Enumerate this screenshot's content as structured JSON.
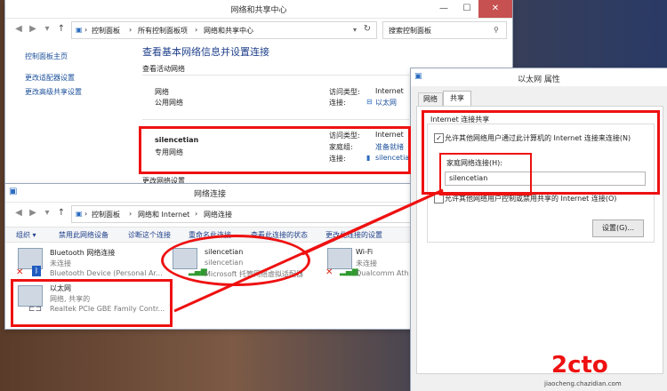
{
  "nsc": {
    "title": "网络和共享中心",
    "breadcrumb": [
      "控制面板",
      "所有控制面板项",
      "网络和共享中心"
    ],
    "search_placeholder": "搜索控制面板",
    "sidebar": [
      "控制面板主页",
      "更改适配器设置",
      "更改高级共享设置"
    ],
    "heading": "查看基本网络信息并设置连接",
    "active_label": "查看活动网络",
    "net1": {
      "name": "网络",
      "type": "公用网络",
      "access_k": "访问类型:",
      "access_v": "Internet",
      "conn_k": "连接:",
      "conn_v": "以太网"
    },
    "net2": {
      "name": "silencetian",
      "type": "专用网络",
      "access_k": "访问类型:",
      "access_v": "Internet",
      "home_k": "家庭组:",
      "home_v": "准备就绪",
      "conn_k": "连接:",
      "conn_v": "silencetia"
    },
    "cutoff": "更改网络设置"
  },
  "nc": {
    "title": "网络连接",
    "breadcrumb": [
      "控制面板",
      "网络和 Internet",
      "网络连接"
    ],
    "toolbar": [
      "组织 ▾",
      "禁用此网络设备",
      "诊断这个连接",
      "重命名此连接",
      "查看此连接的状态",
      "更改此连接的设置"
    ],
    "items": [
      {
        "name": "Bluetooth 网络连接",
        "status": "未连接",
        "device": "Bluetooth Device (Personal Ar..."
      },
      {
        "name": "silencetian",
        "status": "silencetian",
        "device": "Microsoft 托管网络虚拟适配器"
      },
      {
        "name": "Wi-Fi",
        "status": "未连接",
        "device": "Qualcomm Ath"
      },
      {
        "name": "以太网",
        "status": "网络, 共享的",
        "device": "Realtek PCIe GBE Family Contr..."
      }
    ]
  },
  "props": {
    "title": "以太网 属性",
    "tabs": [
      "网络",
      "共享"
    ],
    "group": "Internet 连接共享",
    "check1": "允许其他网络用户通过此计算机的 Internet 连接来连接(N)",
    "home_label": "家庭网络连接(H):",
    "home_value": "silencetian",
    "check2": "允许其他网络用户控制或禁用共享的 Internet 连接(O)",
    "settings_btn": "设置(G)..."
  },
  "watermark": "jiaocheng.chazidian.com",
  "colors": {
    "highlight": "#e11111",
    "link": "#1a4f9a",
    "close": "#c75050"
  }
}
